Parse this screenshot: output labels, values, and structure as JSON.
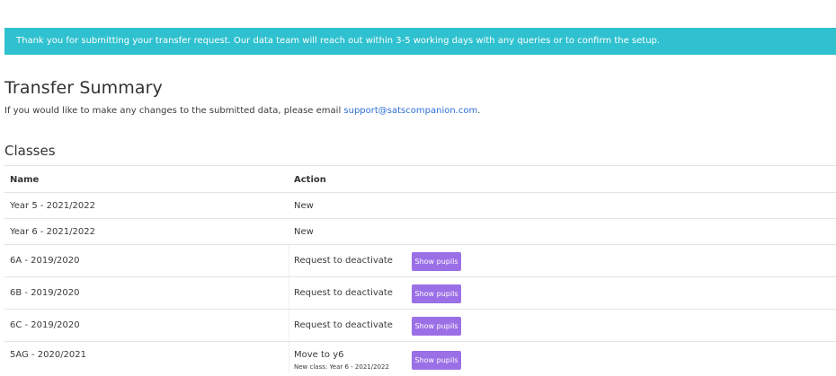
{
  "alert": {
    "message": "Thank you for submitting your transfer request. Our data team will reach out within 3-5 working days with any queries or to confirm the setup."
  },
  "summary": {
    "title": "Transfer Summary",
    "intro_text": "If you would like to make any changes to the submitted data, please email ",
    "email": "support@satscompanion.com",
    "intro_end": "."
  },
  "classes": {
    "title": "Classes",
    "columns": {
      "name": "Name",
      "action": "Action"
    },
    "rows": [
      {
        "name": "Year 5 - 2021/2022",
        "action": "New"
      },
      {
        "name": "Year 6 - 2021/2022",
        "action": "New"
      },
      {
        "name": "6A - 2019/2020",
        "action": "Request to deactivate",
        "button": "Show pupils"
      },
      {
        "name": "6B - 2019/2020",
        "action": "Request to deactivate",
        "button": "Show pupils"
      },
      {
        "name": "6C - 2019/2020",
        "action": "Request to deactivate",
        "button": "Show pupils"
      },
      {
        "name": "5AG - 2020/2021",
        "action": "Move to y6",
        "note": "New class: Year 6 - 2021/2022",
        "button": "Show pupils"
      }
    ]
  },
  "colors": {
    "alert_bg": "#2fc1cf",
    "button_bg": "#9b6fe6",
    "link": "#2f6fd6"
  }
}
